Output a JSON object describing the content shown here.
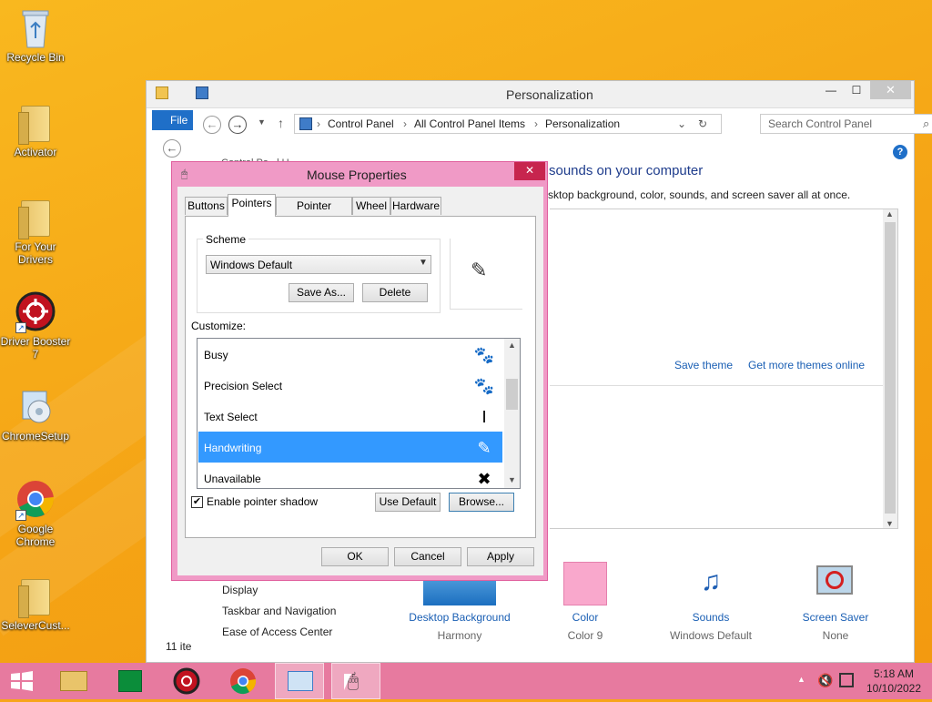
{
  "desktop": {
    "icons": [
      {
        "label": "Recycle Bin",
        "icon": "recycle-bin-icon"
      },
      {
        "label": "Activator",
        "icon": "folder-icon"
      },
      {
        "label": "For Your Drivers",
        "icon": "folder-icon"
      },
      {
        "label": "Driver Booster 7",
        "icon": "driver-booster-icon"
      },
      {
        "label": "ChromeSetup",
        "icon": "setup-icon"
      },
      {
        "label": "Google Chrome",
        "icon": "chrome-icon"
      },
      {
        "label": "SeleverCust...",
        "icon": "folder-icon"
      }
    ]
  },
  "explorer": {
    "title": "Personalization",
    "ribbon_file": "File",
    "breadcrumb": [
      "Control Panel",
      "All Control Panel Items",
      "Personalization"
    ],
    "search_placeholder": "Search Control Panel",
    "heading": "sounds on your computer",
    "subtext": "sktop background, color, sounds, and screen saver all at once.",
    "truncated_left": "Control Pa...l U...",
    "links": {
      "save_theme": "Save theme",
      "get_more_themes": "Get more themes online"
    },
    "see_also": [
      "Display",
      "Taskbar and Navigation",
      "Ease of Access Center"
    ],
    "item_count": "11 ite",
    "bottom_items": [
      {
        "title": "Desktop Background",
        "value": "Harmony"
      },
      {
        "title": "Color",
        "value": "Color 9"
      },
      {
        "title": "Sounds",
        "value": "Windows Default"
      },
      {
        "title": "Screen Saver",
        "value": "None"
      }
    ],
    "color_swatch": "#f9a8cc"
  },
  "mouse_properties": {
    "title": "Mouse Properties",
    "tabs": [
      "Buttons",
      "Pointers",
      "Pointer Options",
      "Wheel",
      "Hardware"
    ],
    "active_tab": "Pointers",
    "scheme_label": "Scheme",
    "scheme_value": "Windows Default",
    "save_as": "Save As...",
    "delete": "Delete",
    "customize_label": "Customize:",
    "cursor_rows": [
      {
        "name": "Busy",
        "icon": "busy-cursor-icon",
        "selected": false
      },
      {
        "name": "Precision Select",
        "icon": "precision-cursor-icon",
        "selected": false
      },
      {
        "name": "Text Select",
        "icon": "text-select-cursor-icon",
        "selected": false
      },
      {
        "name": "Handwriting",
        "icon": "handwriting-cursor-icon",
        "selected": true
      },
      {
        "name": "Unavailable",
        "icon": "unavailable-cursor-icon",
        "selected": false
      }
    ],
    "enable_shadow": "Enable pointer shadow",
    "use_default": "Use Default",
    "browse": "Browse...",
    "ok": "OK",
    "cancel": "Cancel",
    "apply": "Apply"
  },
  "taskbar": {
    "time": "5:18 AM",
    "date": "10/10/2022",
    "accent": "#e77a9f"
  }
}
